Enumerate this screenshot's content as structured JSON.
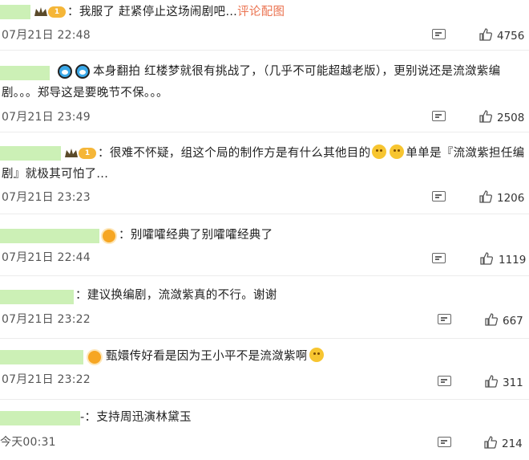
{
  "comments": [
    {
      "prefix": "：",
      "text": "我服了 赶紧停止这场闹剧吧…",
      "link": "评论配图",
      "time": "07月21日 22:48",
      "likes": "4756"
    },
    {
      "text_line1": "本身翻拍 红楼梦就很有挑战了，（几乎不可能超越老版），更别说还是流潋紫编",
      "text_line2": "剧。。。郑导这是要晚节不保。。。",
      "time": "07月21日 23:49",
      "likes": "2508"
    },
    {
      "prefix": "：",
      "text_a": "很难不怀疑，组这个局的制作方是有什么其他目的",
      "text_b": "单单是『流潋紫担任编",
      "text_line2": "剧』就极其可怕了...",
      "time": "07月21日 23:23",
      "likes": "1206"
    },
    {
      "prefix": "：",
      "text": "别嚯嚯经典了别嚯嚯经典了",
      "time": "07月21日 22:44",
      "likes": "1119"
    },
    {
      "prefix": "：",
      "text": "建议换编剧，流潋紫真的不行。谢谢",
      "time": "07月21日 23:22",
      "likes": "667"
    },
    {
      "text": "甄嬛传好看是因为王小平不是流潋紫啊",
      "time": "07月21日 23:22",
      "likes": "311"
    },
    {
      "prefix": "-：",
      "text": "支持周迅演林黛玉",
      "time": "今天00:31",
      "likes": "214"
    }
  ],
  "badge_label": "1",
  "icons": {
    "reply": "reply-icon",
    "like": "thumbs-up-icon"
  },
  "colors": {
    "link": "#eb7350",
    "name_mask": "#ccf0b6"
  }
}
